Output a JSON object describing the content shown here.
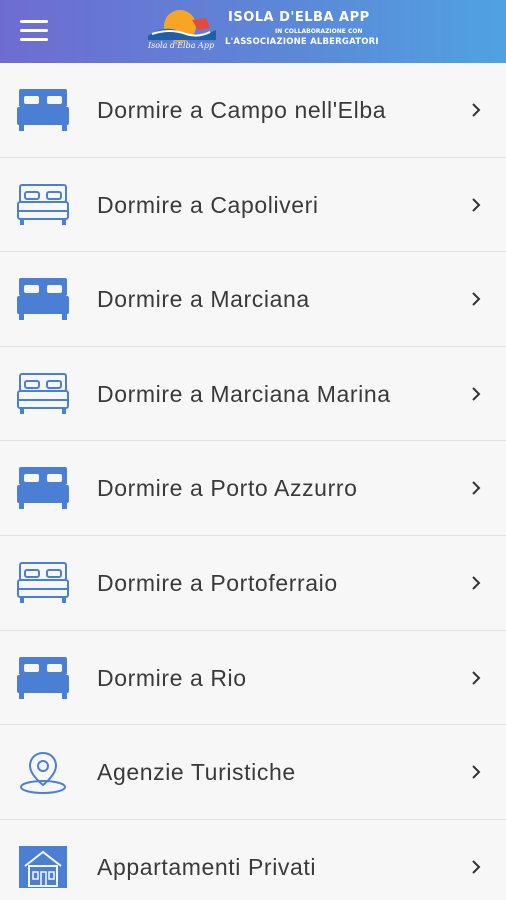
{
  "header": {
    "title": "ISOLA D'ELBA APP",
    "subtitle_line1": "IN COLLABORAZIONE CON",
    "subtitle_line2": "L'ASSOCIAZIONE ALBERGATORI",
    "logo_script": "Isola d'Elba App",
    "gradient_colors": [
      "#6f6cd0",
      "#4fa2e2"
    ]
  },
  "accent_color": "#4a7fd4",
  "items": [
    {
      "label": "Dormire a Campo nell'Elba",
      "icon": "bed-filled-icon"
    },
    {
      "label": "Dormire a Capoliveri",
      "icon": "bed-outline-icon"
    },
    {
      "label": "Dormire a Marciana",
      "icon": "bed-filled-icon"
    },
    {
      "label": "Dormire a Marciana Marina",
      "icon": "bed-outline-icon"
    },
    {
      "label": "Dormire a Porto Azzurro",
      "icon": "bed-filled-icon"
    },
    {
      "label": "Dormire a Portoferraio",
      "icon": "bed-outline-icon"
    },
    {
      "label": "Dormire a Rio",
      "icon": "bed-filled-icon"
    },
    {
      "label": "Agenzie Turistiche",
      "icon": "map-pin-icon"
    },
    {
      "label": "Appartamenti Privati",
      "icon": "house-icon"
    }
  ]
}
